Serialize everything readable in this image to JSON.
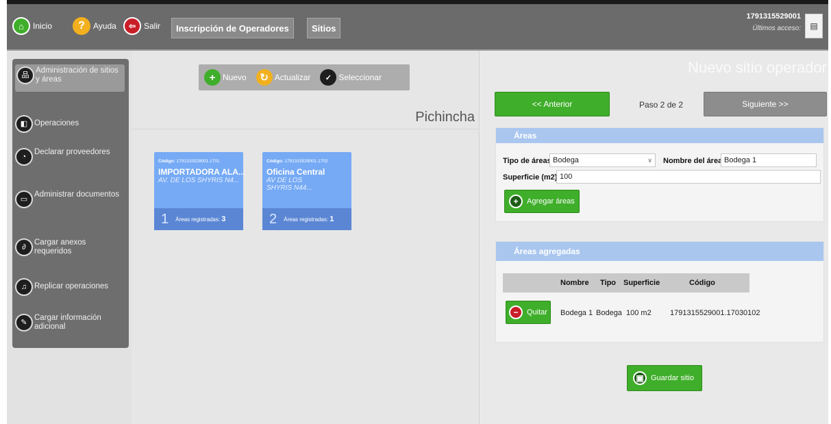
{
  "topbar": {
    "inicio": "Inicio",
    "ayuda": "Ayuda",
    "salir": "Salir",
    "tab_inscripcion": "Inscripción de Operadores",
    "tab_sitios": "Sitios",
    "user_id": "1791315529001",
    "last_access": "Últimos acceso:"
  },
  "sidebar": {
    "items": [
      {
        "label": "Administración de sitios y áreas",
        "icon": "sitemap-icon"
      },
      {
        "label": "Operaciones",
        "icon": "operations-icon"
      },
      {
        "label": "Declarar proveedores",
        "icon": "providers-icon"
      },
      {
        "label": "Administrar documentos",
        "icon": "documents-icon"
      },
      {
        "label": "Cargar anexos requeridos",
        "icon": "attachment-icon"
      },
      {
        "label": "Replicar operaciones",
        "icon": "replicate-icon"
      },
      {
        "label": "Cargar información adicional",
        "icon": "info-icon"
      }
    ]
  },
  "toolbar": {
    "nuevo": "Nuevo",
    "actualizar": "Actualizar",
    "seleccionar": "Seleccionar"
  },
  "province": "Pichincha",
  "cards": [
    {
      "code_label": "Código:",
      "code": "1791315529001.1701",
      "name": "IMPORTADORA ALA...",
      "address": "AV. DE LOS SHYRIS N4...",
      "number": "1",
      "areas_label": "Áreas registradas:",
      "areas_count": "3"
    },
    {
      "code_label": "Código:",
      "code": "1791315529001.1702",
      "name": "Oficina Central",
      "address": "AV DE LOS SHYRIS N44...",
      "number": "2",
      "areas_label": "Áreas registradas:",
      "areas_count": "1"
    }
  ],
  "right": {
    "title": "Nuevo sitio operador",
    "prev": "<< Anterior",
    "step": "Paso 2 de 2",
    "next": "Siguiente >>",
    "areas_header": "Áreas",
    "tipo_label": "Tipo de áreas",
    "tipo_value": "Bodega",
    "nombre_label": "Nombre del área",
    "nombre_value": "Bodega 1",
    "superficie_label": "Superficie (m2)",
    "superficie_value": "100",
    "add_btn": "Agregar áreas",
    "added_header": "Áreas agregadas",
    "table": {
      "headers": [
        "Nombre",
        "Tipo",
        "Superficie",
        "Código"
      ],
      "rows": [
        {
          "remove": "Quitar",
          "nombre": "Bodega 1",
          "tipo": "Bodega",
          "superficie": "100 m2",
          "codigo": "1791315529001.17030102"
        }
      ]
    },
    "save_btn": "Guardar sitio"
  },
  "colors": {
    "accent_green": "#3fae2a",
    "card_blue": "#76aaf5",
    "panel_header": "#a9c6ef",
    "topbar": "#6b6b6b"
  }
}
